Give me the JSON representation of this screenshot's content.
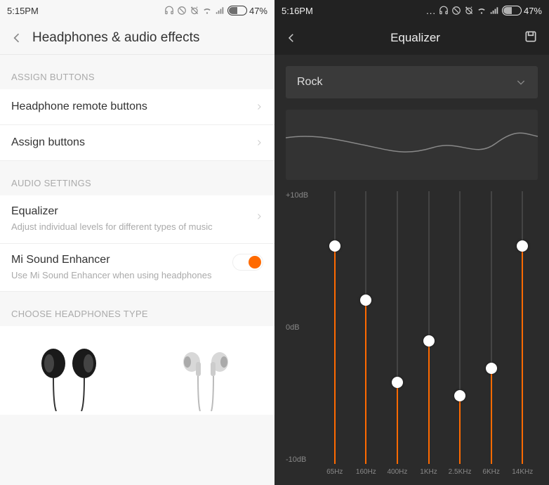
{
  "left": {
    "statusbar": {
      "time": "5:15PM",
      "battery": "47%"
    },
    "header": {
      "title": "Headphones & audio effects"
    },
    "sections": {
      "assign_label": "ASSIGN BUTTONS",
      "assign_items": [
        {
          "title": "Headphone remote buttons"
        },
        {
          "title": "Assign buttons"
        }
      ],
      "audio_label": "AUDIO SETTINGS",
      "equalizer": {
        "title": "Equalizer",
        "sub": "Adjust individual levels for different types of music"
      },
      "enhancer": {
        "title": "Mi Sound Enhancer",
        "sub": "Use Mi Sound Enhancer when using headphones"
      },
      "hp_label": "CHOOSE HEADPHONES TYPE"
    }
  },
  "right": {
    "statusbar": {
      "time": "5:16PM",
      "battery": "47%"
    },
    "header": {
      "title": "Equalizer"
    },
    "preset": "Rock",
    "y_labels": {
      "top": "+10dB",
      "mid": "0dB",
      "bot": "-10dB"
    },
    "bands": [
      {
        "freq": "65Hz",
        "db": 6
      },
      {
        "freq": "160Hz",
        "db": 2
      },
      {
        "freq": "400Hz",
        "db": -4
      },
      {
        "freq": "1KHz",
        "db": -1
      },
      {
        "freq": "2.5KHz",
        "db": -5
      },
      {
        "freq": "6KHz",
        "db": -3
      },
      {
        "freq": "14KHz",
        "db": 6
      }
    ]
  }
}
